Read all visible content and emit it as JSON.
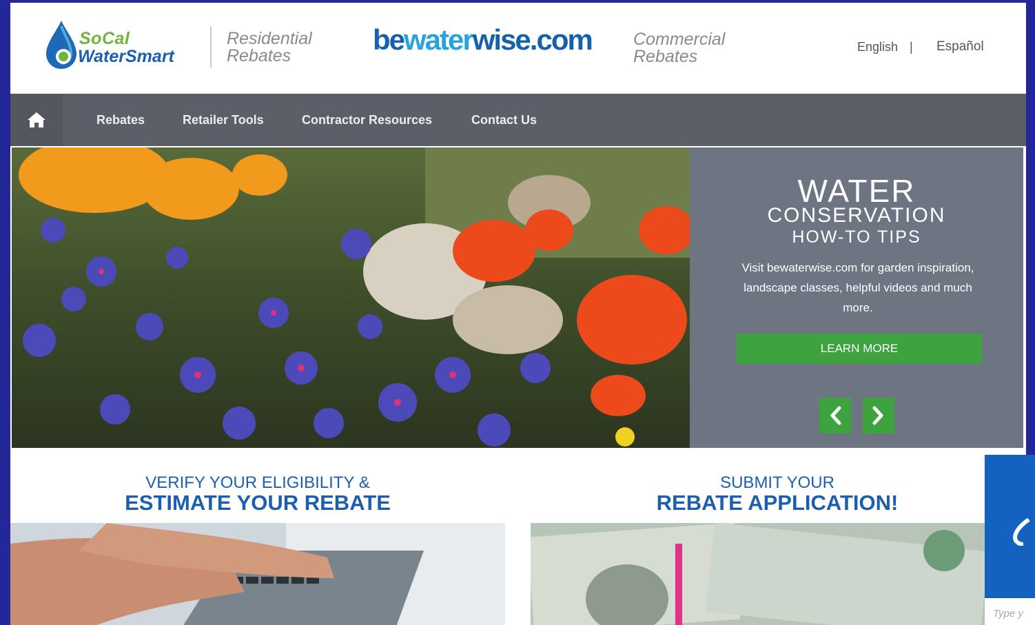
{
  "header": {
    "logo_line1": "SoCal",
    "logo_line2": "WaterSmart",
    "residential_line1": "Residential",
    "residential_line2": "Rebates",
    "brand_be": "be",
    "brand_water": "water",
    "brand_wise": "wise.com",
    "commercial_line1": "Commercial",
    "commercial_line2": "Rebates",
    "lang_english": "English",
    "lang_separator": "|",
    "lang_spanish": "Español"
  },
  "nav": {
    "home_icon": "home-icon",
    "items": [
      {
        "label": "Rebates"
      },
      {
        "label": "Retailer Tools"
      },
      {
        "label": "Contractor Resources"
      },
      {
        "label": "Contact Us"
      }
    ]
  },
  "hero": {
    "title_line1": "WATER",
    "title_line2": "CONSERVATION",
    "title_line3": "HOW-TO TIPS",
    "description": "Visit bewaterwise.com for garden inspiration, landscape classes, helpful videos and much more.",
    "learn_more": "LEARN MORE",
    "prev_icon": "chevron-left-icon",
    "next_icon": "chevron-right-icon"
  },
  "sections": [
    {
      "sub": "VERIFY YOUR ELIGIBILITY &",
      "main": "ESTIMATE YOUR REBATE"
    },
    {
      "sub": "SUBMIT YOUR",
      "main": "REBATE APPLICATION!"
    }
  ],
  "side_widget": {
    "placeholder": "Type y"
  },
  "colors": {
    "frame": "#23279a",
    "nav_bg": "#5c5f67",
    "panel_bg": "#6d7482",
    "button_green": "#3ea23f",
    "heading_blue": "#1c5fae"
  }
}
